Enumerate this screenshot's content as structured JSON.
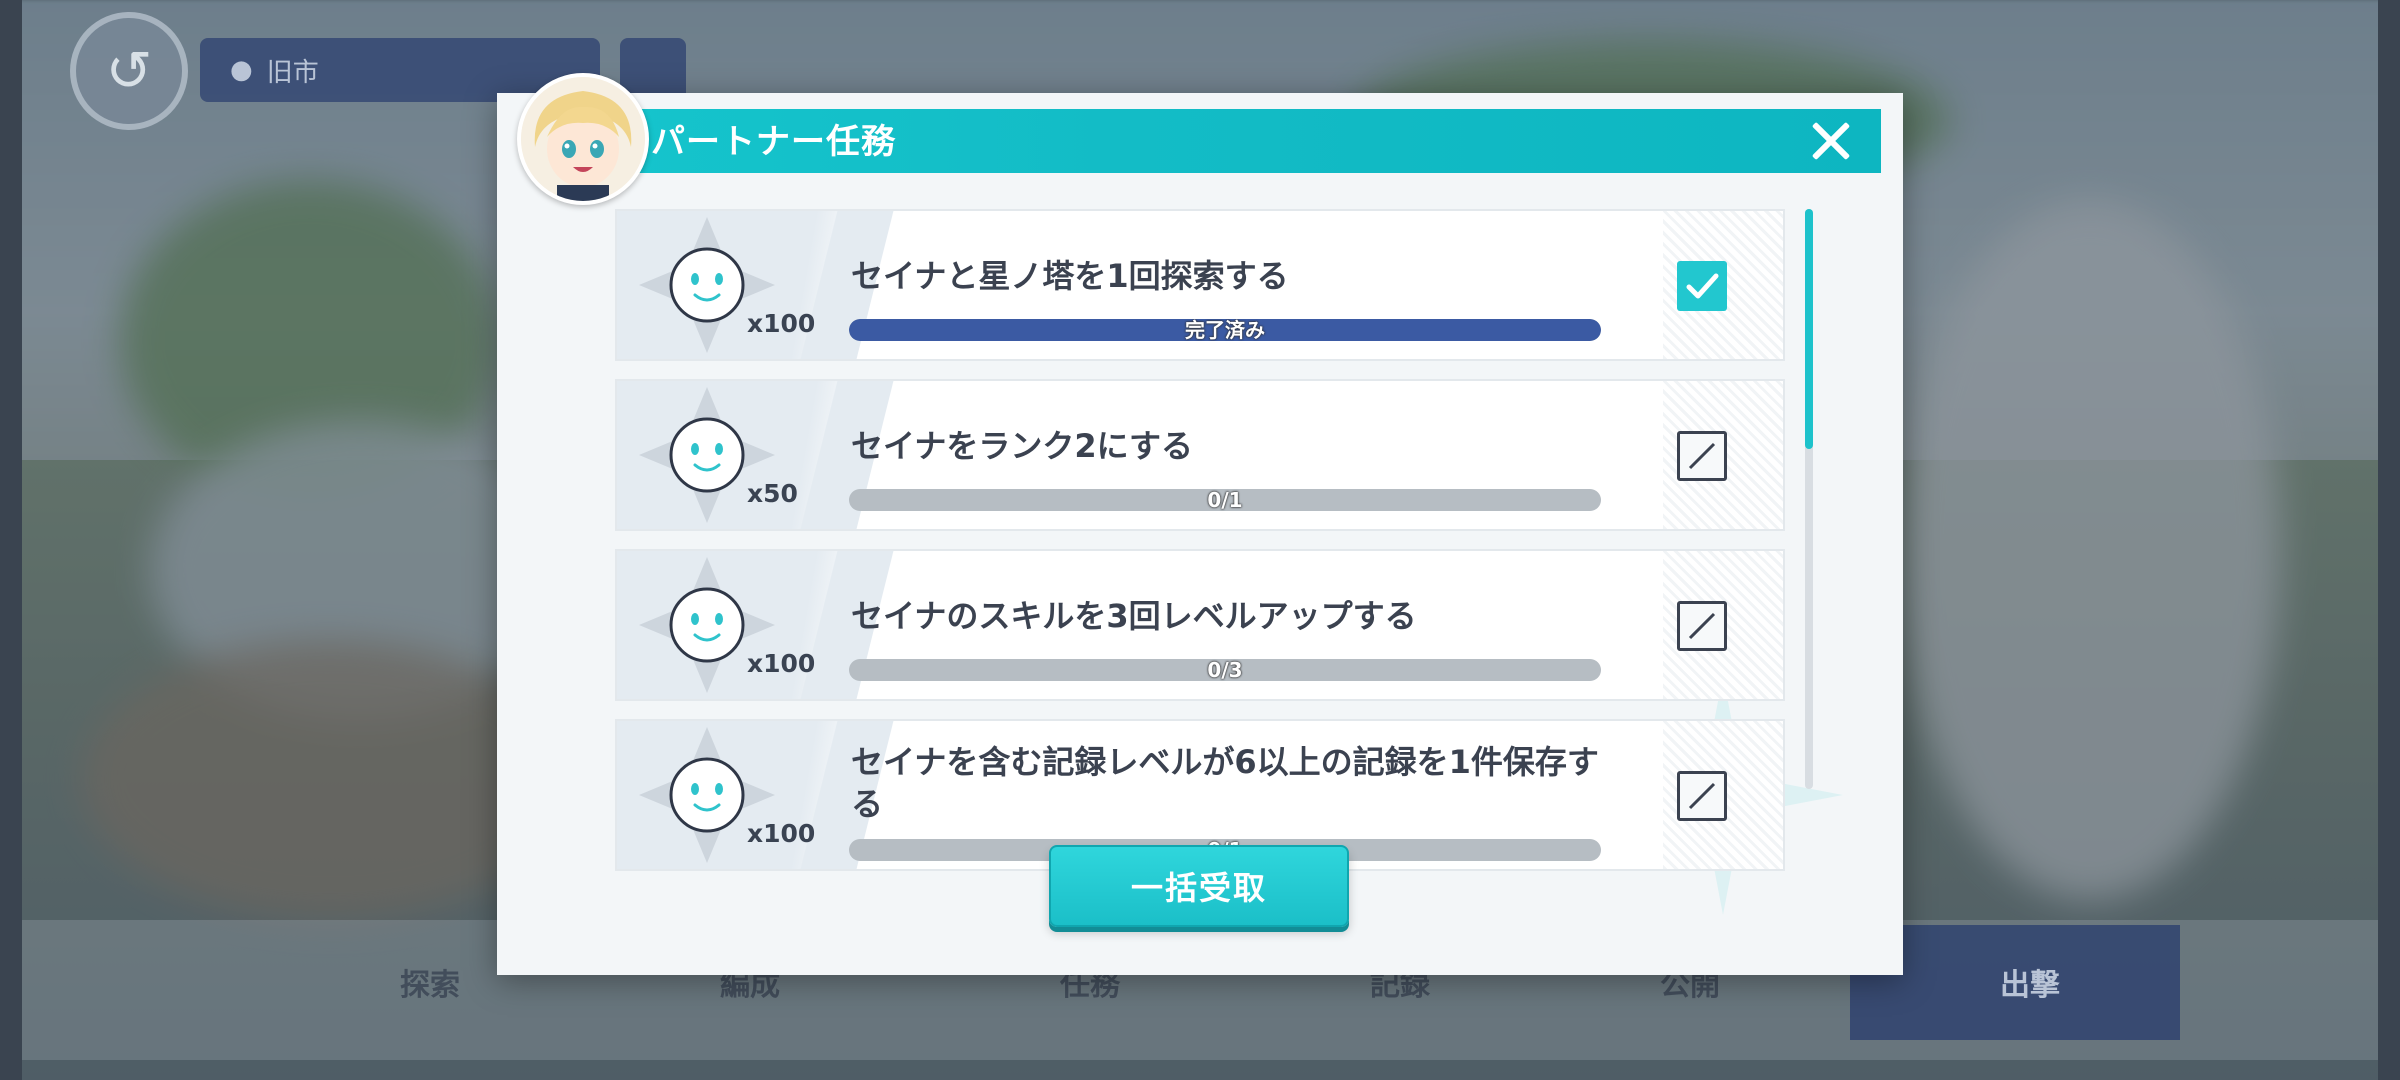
{
  "background": {
    "location_label": "旧市",
    "nav_items": [
      "探索",
      "編成",
      "任務",
      "記録",
      "公開",
      "出撃"
    ]
  },
  "dialog": {
    "title": "パートナー任務",
    "close_icon": "close-icon",
    "avatar": "partner-avatar",
    "claim_all_label": "一括受取"
  },
  "missions": [
    {
      "title": "セイナと星ノ塔を1回探索する",
      "reward_count": "x100",
      "progress_label": "完了済み",
      "progress": 1.0,
      "completed": true
    },
    {
      "title": "セイナをランク2にする",
      "reward_count": "x50",
      "progress_label": "0/1",
      "progress": 0.0,
      "completed": false
    },
    {
      "title": "セイナのスキルを3回レベルアップする",
      "reward_count": "x100",
      "progress_label": "0/3",
      "progress": 0.0,
      "completed": false
    },
    {
      "title": "セイナを含む記録レベルが6以上の記録を1件保存する",
      "reward_count": "x100",
      "progress_label": "0/1",
      "progress": 0.0,
      "completed": false
    }
  ],
  "colors": {
    "accent": "#15c4cc",
    "progress_done": "#3b5aa3",
    "progress_empty": "#b6bdc3",
    "text_dark": "#3b4250"
  }
}
